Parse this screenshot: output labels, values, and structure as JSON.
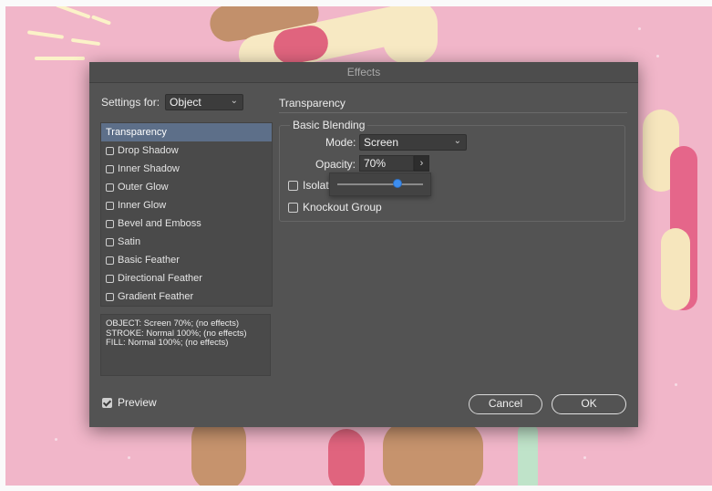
{
  "dialog": {
    "title": "Effects",
    "settings_label": "Settings for:",
    "settings_value": "Object",
    "effects": [
      {
        "label": "Transparency",
        "checkbox": false,
        "selected": true
      },
      {
        "label": "Drop Shadow",
        "checkbox": true,
        "selected": false
      },
      {
        "label": "Inner Shadow",
        "checkbox": true,
        "selected": false
      },
      {
        "label": "Outer Glow",
        "checkbox": true,
        "selected": false
      },
      {
        "label": "Inner Glow",
        "checkbox": true,
        "selected": false
      },
      {
        "label": "Bevel and Emboss",
        "checkbox": true,
        "selected": false
      },
      {
        "label": "Satin",
        "checkbox": true,
        "selected": false
      },
      {
        "label": "Basic Feather",
        "checkbox": true,
        "selected": false
      },
      {
        "label": "Directional Feather",
        "checkbox": true,
        "selected": false
      },
      {
        "label": "Gradient Feather",
        "checkbox": true,
        "selected": false
      }
    ],
    "summary_lines": [
      "OBJECT: Screen 70%; (no effects)",
      "STROKE: Normal 100%; (no effects)",
      "FILL: Normal 100%; (no effects)"
    ],
    "preview_label": "Preview",
    "section_title": "Transparency",
    "group_title": "Basic Blending",
    "mode_label": "Mode:",
    "mode_value": "Screen",
    "opacity_label": "Opacity:",
    "opacity_value": "70%",
    "opacity_level": 0.7,
    "isolate_label": "Isolat",
    "knockout_label": "Knockout Group",
    "cancel_label": "Cancel",
    "ok_label": "OK"
  },
  "icons": {
    "chevron": "chevron-down-icon",
    "arrow": "chevron-right-icon",
    "check": "check-icon"
  },
  "colors": {
    "background": "#f1b6c9",
    "dialog": "#535353",
    "selection": "#5d6f89",
    "slider_thumb": "#3d8ef0"
  }
}
